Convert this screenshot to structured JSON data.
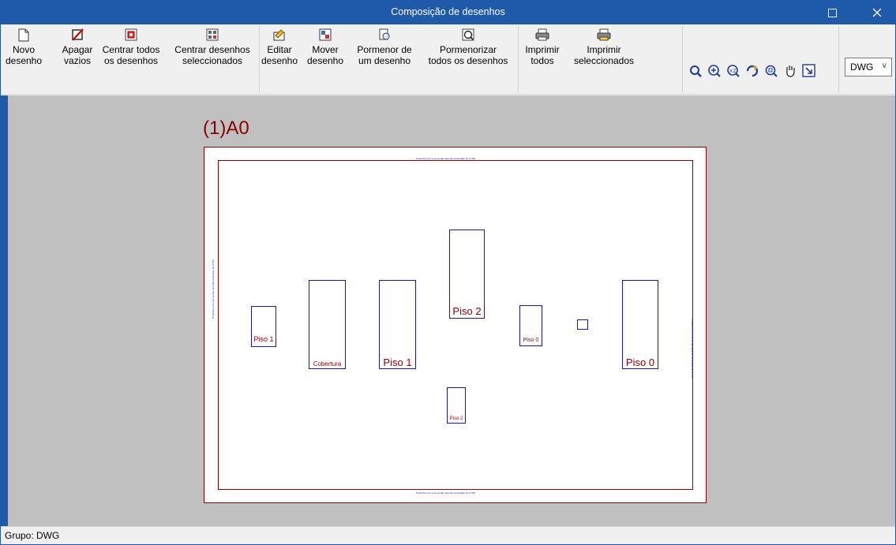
{
  "window": {
    "title": "Composição de desenhos",
    "maximize_glyph": "☐",
    "close_glyph": "✕"
  },
  "toolbar": {
    "buttons": [
      {
        "label": "Novo\ndesenho",
        "icon": "new-document-icon"
      },
      {
        "label": "Apagar\nvazios",
        "icon": "delete-empty-icon"
      },
      {
        "label": "Centrar todos\nos desenhos",
        "icon": "center-all-icon"
      },
      {
        "label": "Centrar desenhos\nseleccionados",
        "icon": "center-selected-icon"
      },
      {
        "label": "Editar\ndesenho",
        "icon": "edit-drawing-icon"
      },
      {
        "label": "Mover\ndesenho",
        "icon": "move-drawing-icon"
      },
      {
        "label": "Pormenor de\num desenho",
        "icon": "detail-drawing-icon"
      },
      {
        "label": "Pormenorizar\ntodos os desenhos",
        "icon": "detail-all-icon"
      },
      {
        "label": "Imprimir\ntodos",
        "icon": "print-all-icon"
      },
      {
        "label": "Imprimir\nseleccionados",
        "icon": "print-selected-icon"
      }
    ],
    "view_tools": [
      "redraw-icon",
      "zoom-extents-icon",
      "zoom-x2-icon",
      "refresh-icon",
      "zoom-window-icon",
      "pan-hand-icon",
      "export-view-icon"
    ],
    "format_select": {
      "value": "DWG",
      "caret": "∨"
    }
  },
  "sheet": {
    "title": "(1)A0",
    "frame_note": "Produzido por uma versão para demonstração do CYPE",
    "drawings": [
      {
        "label": "Piso 1"
      },
      {
        "label": "Cobertura"
      },
      {
        "label": "Piso 1"
      },
      {
        "label": "Piso 2"
      },
      {
        "label": "Piso 0"
      },
      {
        "label": ""
      },
      {
        "label": "Piso 0"
      },
      {
        "label": "Piso 2"
      }
    ]
  },
  "status": {
    "text": "Grupo: DWG"
  },
  "colors": {
    "titlebar": "#1e5aa8",
    "sheet_border": "#8b0000",
    "drawing_border": "#1a1aa0",
    "workspace": "#c0c0c0"
  }
}
